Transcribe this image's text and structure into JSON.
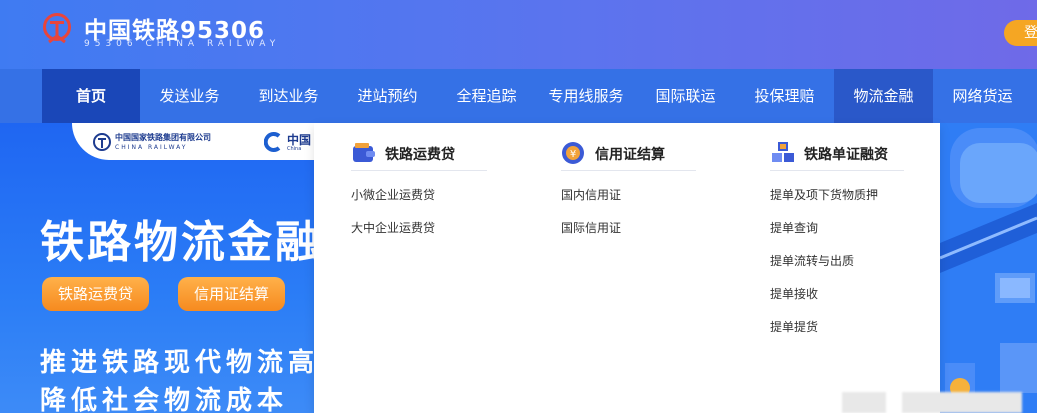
{
  "header": {
    "title": "中国铁路95306",
    "subtitle": "95306 CHINA RAILWAY",
    "login_label": "登"
  },
  "nav": {
    "items": [
      {
        "label": "首页"
      },
      {
        "label": "发送业务"
      },
      {
        "label": "到达业务"
      },
      {
        "label": "进站预约"
      },
      {
        "label": "全程追踪"
      },
      {
        "label": "专用线服务"
      },
      {
        "label": "国际联运"
      },
      {
        "label": "投保理赔"
      },
      {
        "label": "物流金融"
      },
      {
        "label": "网络货运"
      }
    ]
  },
  "banner": {
    "logo1_cn": "中国国家铁路集团有限公司",
    "logo1_en": "CHINA RAILWAY",
    "logo2_cn": "中国",
    "logo2_en": "China",
    "headline": "铁路物流金融",
    "pill1": "铁路运费贷",
    "pill2": "信用证结算",
    "slogan1": "推进铁路现代物流高",
    "slogan2": "降低社会物流成本"
  },
  "dropdown": {
    "columns": [
      {
        "title": "铁路运费贷",
        "icon": "wallet-icon",
        "links": [
          "小微企业运费贷",
          "大中企业运费贷"
        ]
      },
      {
        "title": "信用证结算",
        "icon": "yuan-shield-icon",
        "links": [
          "国内信用证",
          "国际信用证"
        ]
      },
      {
        "title": "铁路单证融资",
        "icon": "cubes-icon",
        "links": [
          "提单及项下货物质押",
          "提单查询",
          "提单流转与出质",
          "提单接收",
          "提单提货"
        ]
      }
    ]
  },
  "colors": {
    "header_start": "#3f7bf2",
    "nav_bg": "#3571e6",
    "nav_home": "#1a47b8",
    "accent_orange": "#f68a1f"
  }
}
